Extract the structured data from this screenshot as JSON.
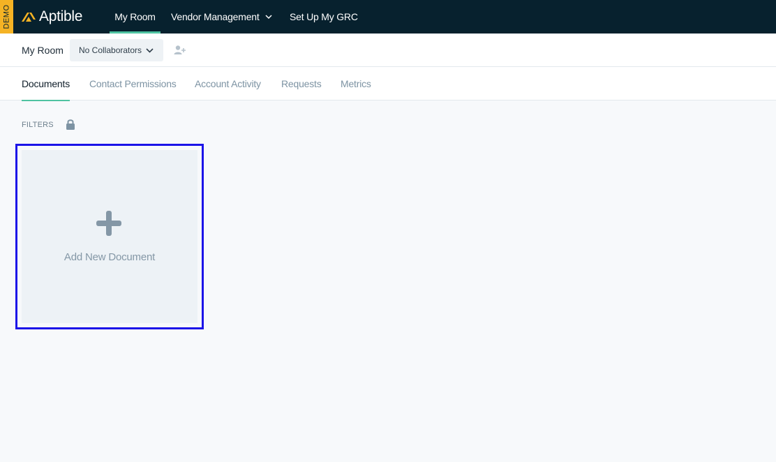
{
  "app": {
    "demo_badge": "DEMO",
    "brand_name": "Aptible",
    "brand_color": "#f5b324"
  },
  "topnav": {
    "items": [
      {
        "label": "My Room",
        "active": true
      },
      {
        "label": "Vendor Management",
        "has_dropdown": true
      },
      {
        "label": "Set Up My GRC"
      }
    ]
  },
  "room": {
    "title": "My Room",
    "collaborators_label": "No Collaborators",
    "add_collaborator_icon": "add-user-icon"
  },
  "tabs": [
    {
      "label": "Documents",
      "active": true
    },
    {
      "label": "Contact Permissions"
    },
    {
      "label": "Account Activity"
    },
    {
      "label": "Requests"
    },
    {
      "label": "Metrics"
    }
  ],
  "filters": {
    "label": "FILTERS",
    "icon": "lock-icon"
  },
  "documents": {
    "add_new_label": "Add New Document",
    "icon": "plus-icon"
  },
  "colors": {
    "topbar": "#07212e",
    "accent": "#4fc3a1",
    "highlight": "#1b14e8"
  }
}
